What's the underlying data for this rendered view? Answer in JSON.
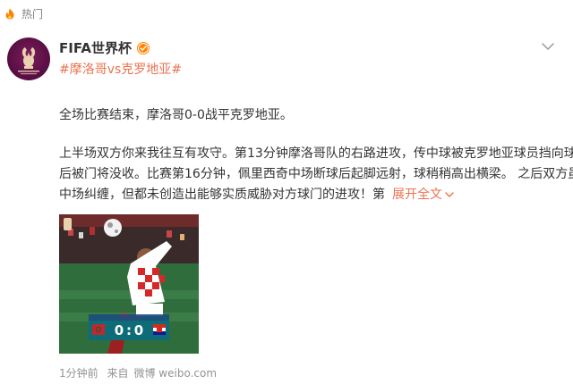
{
  "header": {
    "label": "热门",
    "icon": "hot-flame-icon"
  },
  "post": {
    "author": "FIFA世界杯",
    "verified_badge": "verified-badge-icon",
    "topic": "#摩洛哥vs克罗地亚#",
    "paragraph1": "全场比赛结束，摩洛哥0-0战平克罗地亚。",
    "paragraph2_lines": [
      "上半场双方你来我往互有攻守。第13分钟摩洛哥队的右路进攻，传中球被克罗地亚球员挡向球门",
      "后被门将没收。比赛第16分钟，佩里西奇中场断球后起脚远射，球稍稍高出横梁。 之后双方虽在",
      "中场纠缠，但都未创造出能够实质威胁对方球门的进攻！第"
    ],
    "expand_label": "展开全文",
    "score_home": "0",
    "score_sep": ":",
    "score_away": "0",
    "time": "1分钟前",
    "source_prefix": "来自",
    "source": "微博 weibo.com"
  },
  "colors": {
    "accent": "#eb7350",
    "text": "#333333",
    "muted": "#939393",
    "verified": "#ff8200"
  }
}
